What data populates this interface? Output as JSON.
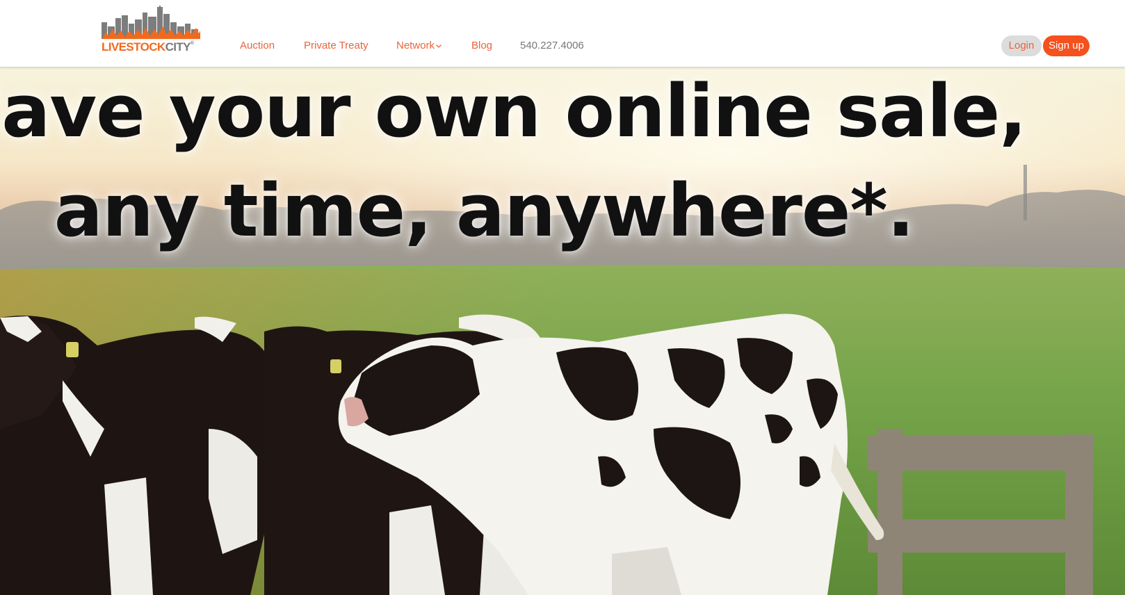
{
  "brand": {
    "logo_part_a": "LIVESTOCK",
    "logo_part_b": "CITY",
    "logo_mark": "®",
    "accent_color": "#f06a1e",
    "grey_color": "#7a7a7a"
  },
  "nav": {
    "items": [
      {
        "label": "Auction"
      },
      {
        "label": "Private Treaty"
      },
      {
        "label": "Network",
        "icon": "chevron-down-icon"
      },
      {
        "label": "Blog"
      }
    ],
    "phone": "540.227.4006"
  },
  "auth": {
    "login_label": "Login",
    "signup_label": "Sign up",
    "signup_color": "#f4511e"
  },
  "hero": {
    "headline_line1": "Have your own online sale,",
    "headline_line2": "any time, anywhere*.",
    "image": "cows-in-pasture-at-sunset"
  }
}
